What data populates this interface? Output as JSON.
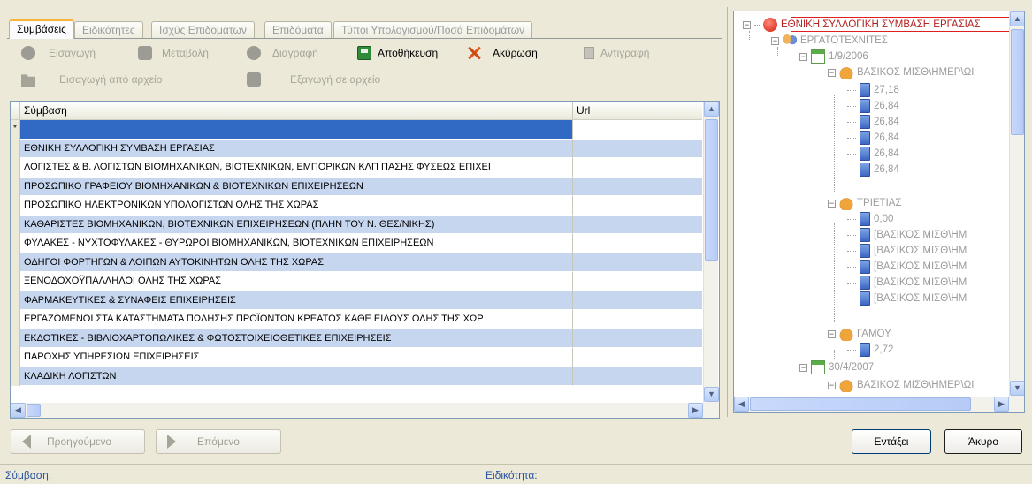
{
  "tabs": [
    "Συμβάσεις",
    "Ειδικότητες",
    "Ισχύς Επιδομάτων",
    "Επιδόματα",
    "Τύποι Υπολογισμού/Ποσά Επιδομάτων"
  ],
  "toolbar": {
    "insert": "Εισαγωγή",
    "modify": "Μεταβολή",
    "delete": "Διαγραφή",
    "save": "Αποθήκευση",
    "cancel": "Ακύρωση",
    "copy": "Αντιγραφή",
    "import": "Εισαγωγή από αρχείο",
    "export": "Εξαγωγή σε αρχείο"
  },
  "grid": {
    "columns": [
      "Σύμβαση",
      "Url"
    ],
    "new_row_marker": "*",
    "rows": [
      "",
      "ΕΘΝΙΚΗ ΣΥΛΛΟΓΙΚΗ ΣΥΜΒΑΣΗ ΕΡΓΑΣΙΑΣ",
      "ΛΟΓΙΣΤΕΣ & Β. ΛΟΓΙΣΤΩΝ ΒΙΟΜΗΧΑΝΙΚΩΝ, ΒΙΟΤΕΧΝΙΚΩΝ, ΕΜΠΟΡΙΚΩΝ ΚΛΠ ΠΑΣΗΣ ΦΥΣΕΩΣ ΕΠΙΧΕΙ",
      "ΠΡΟΣΩΠΙΚΟ ΓΡΑΦΕΙΟΥ ΒΙΟΜΗΧΑΝΙΚΩΝ & ΒΙΟΤΕΧΝΙΚΩΝ ΕΠΙΧΕΙΡΗΣΕΩΝ",
      "ΠΡΟΣΩΠΙΚΟ ΗΛΕΚΤΡΟΝΙΚΩΝ ΥΠΟΛΟΓΙΣΤΩΝ ΟΛΗΣ ΤΗΣ ΧΩΡΑΣ",
      "ΚΑΘΑΡΙΣΤΕΣ ΒΙΟΜΗΧΑΝΙΚΩΝ, ΒΙΟΤΕΧΝΙΚΩΝ ΕΠΙΧΕΙΡΗΣΕΩΝ (ΠΛΗΝ ΤΟΥ Ν. ΘΕΣ/ΝΙΚΗΣ)",
      "ΦΥΛΑΚΕΣ - ΝΥΧΤΟΦΥΛΑΚΕΣ - ΘΥΡΩΡΟΙ ΒΙΟΜΗΧΑΝΙΚΩΝ, ΒΙΟΤΕΧΝΙΚΩΝ ΕΠΙΧΕΙΡΗΣΕΩΝ",
      "ΟΔΗΓΟΙ ΦΟΡΤΗΓΩΝ & ΛΟΙΠΩΝ ΑΥΤΟΚΙΝΗΤΩΝ ΟΛΗΣ ΤΗΣ ΧΩΡΑΣ",
      "ΞΕΝΟΔΟΧΟΫΠΑΛΛΗΛΟΙ ΟΛΗΣ ΤΗΣ ΧΩΡΑΣ",
      "ΦΑΡΜΑΚΕΥΤΙΚΕΣ & ΣΥΝΑΦΕΙΣ ΕΠΙΧΕΙΡΗΣΕΙΣ",
      "ΕΡΓΑΖΟΜΕΝΟΙ ΣΤΑ ΚΑΤΑΣΤΗΜΑΤΑ ΠΩΛΗΣΗΣ ΠΡΟΪΟΝΤΩΝ ΚΡΕΑΤΟΣ ΚΑΘΕ ΕΙΔΟΥΣ ΟΛΗΣ ΤΗΣ ΧΩΡ",
      "ΕΚΔΟΤΙΚΕΣ - ΒΙΒΛΙΟΧΑΡΤΟΠΩΛΙΚΕΣ & ΦΩΤΟΣΤΟΙΧΕΙΟΘΕΤΙΚΕΣ ΕΠΙΧΕΙΡΗΣΕΙΣ",
      "ΠΑΡΟΧΗΣ ΥΠΗΡΕΣΙΩΝ ΕΠΙΧΕΙΡΗΣΕΙΣ",
      "ΚΛΑΔΙΚΗ ΛΟΓΙΣΤΩΝ"
    ]
  },
  "tree": {
    "root": "ΕΘΝΙΚΗ ΣΥΛΛΟΓΙΚΗ ΣΥΜΒΑΣΗ ΕΡΓΑΣΙΑΣ",
    "specialty": "ΕΡΓΑΤΟΤΕΧΝΙΤΕΣ",
    "date1": "1/9/2006",
    "basic_salary": "ΒΑΣΙΚΟΣ ΜΙΣΘ\\ΗΜΕΡ\\ΩΙ",
    "basic_values": [
      "27,18",
      "26,84",
      "26,84",
      "26,84",
      "26,84",
      "26,84"
    ],
    "trieties": "ΤΡΙΕΤΙΑΣ",
    "trieties_values": [
      "0,00",
      "[ΒΑΣΙΚΟΣ ΜΙΣΘ\\ΗΜ",
      "[ΒΑΣΙΚΟΣ ΜΙΣΘ\\ΗΜ",
      "[ΒΑΣΙΚΟΣ ΜΙΣΘ\\ΗΜ",
      "[ΒΑΣΙΚΟΣ ΜΙΣΘ\\ΗΜ",
      "[ΒΑΣΙΚΟΣ ΜΙΣΘ\\ΗΜ"
    ],
    "gamou": "ΓΑΜΟΥ",
    "gamou_value": "2,72",
    "date2": "30/4/2007",
    "basic_salary2": "ΒΑΣΙΚΟΣ ΜΙΣΘ\\ΗΜΕΡ\\ΩΙ"
  },
  "nav": {
    "prev": "Προηγούμενο",
    "next": "Επόμενο"
  },
  "actions": {
    "ok": "Εντάξει",
    "cancel": "Άκυρο"
  },
  "status": {
    "contract_label": "Σύμβαση:",
    "specialty_label": "Ειδικότητα:"
  }
}
